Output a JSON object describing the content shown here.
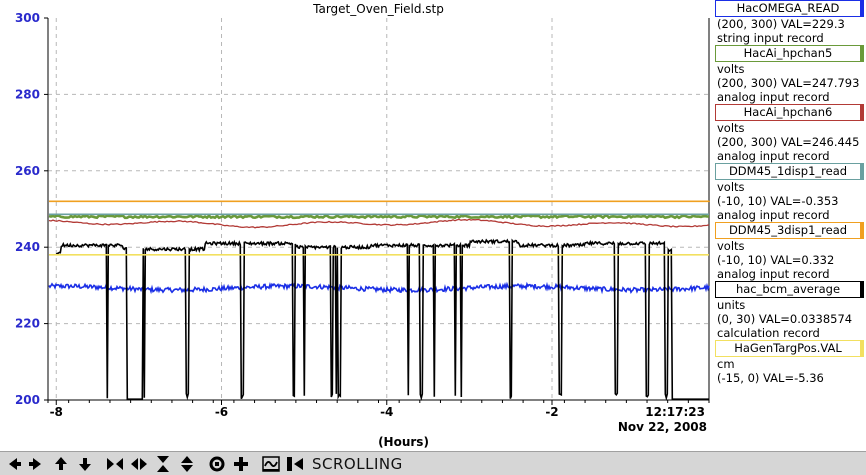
{
  "chart_data": {
    "type": "line",
    "title": "Target_Oven_Field.stp",
    "xlabel": "(Hours)",
    "ylabel": "",
    "xlim": [
      -8.1,
      -0.1
    ],
    "ylim": [
      200,
      300
    ],
    "xticks": [
      -8,
      -6,
      -4,
      -2
    ],
    "yticks": [
      200,
      220,
      240,
      260,
      280,
      300
    ],
    "grid": true,
    "time_label": "12:17:23",
    "date_label": "Nov 22, 2008",
    "series": [
      {
        "name": "HacOMEGA_READ",
        "color": "#1a2ee6",
        "level": 229.3,
        "kind": "noisy"
      },
      {
        "name": "HacAi_hpchan5",
        "color": "#6a9a3a",
        "level": 248.0,
        "kind": "band"
      },
      {
        "name": "HacAi_hpchan6",
        "color": "#b23a36",
        "level": 246.2,
        "kind": "wave"
      },
      {
        "name": "DDM45_1disp1_read",
        "color": "#6aa0a0",
        "level": 248.6,
        "kind": "flat"
      },
      {
        "name": "DDM45_3disp1_read",
        "color": "#f0a020",
        "level": 252.0,
        "kind": "flat"
      },
      {
        "name": "hac_bcm_average",
        "color": "#000000",
        "kind": "trips"
      },
      {
        "name": "HaGenTargPos.VAL",
        "color": "#f2e060",
        "level": 238.0,
        "kind": "flat"
      }
    ],
    "trips_upper_segments": [
      [
        -8.0,
        -7.95,
        238.5
      ],
      [
        -7.95,
        -7.2,
        240.5
      ],
      [
        -7.2,
        -6.2,
        239.5
      ],
      [
        -6.2,
        -5.1,
        241.0
      ],
      [
        -5.1,
        -4.2,
        240.0
      ],
      [
        -4.2,
        -3.0,
        240.5
      ],
      [
        -3.0,
        -2.4,
        241.5
      ],
      [
        -2.4,
        -1.6,
        240.5
      ],
      [
        -1.6,
        -0.6,
        241.0
      ],
      [
        -0.6,
        -0.55,
        239.0
      ]
    ],
    "trips_low_gaps": [
      [
        -7.15,
        -6.95
      ],
      [
        -0.55,
        -0.12
      ]
    ]
  },
  "legend": [
    {
      "name": "HacOMEGA_READ",
      "color": "#1a2ee6",
      "unit": "",
      "range_line": "(200, 300) VAL=229.3",
      "record": "string input record"
    },
    {
      "name": "HacAi_hpchan5",
      "color": "#6a9a3a",
      "unit": "volts",
      "range_line": "(200, 300) VAL=247.793",
      "record": "analog input record"
    },
    {
      "name": "HacAi_hpchan6",
      "color": "#b23a36",
      "unit": "volts",
      "range_line": "(200, 300) VAL=246.445",
      "record": "analog input record"
    },
    {
      "name": "DDM45_1disp1_read",
      "color": "#6aa0a0",
      "unit": "volts",
      "range_line": "(-10, 10) VAL=-0.353",
      "record": "analog input record"
    },
    {
      "name": "DDM45_3disp1_read",
      "color": "#f0a020",
      "unit": "volts",
      "range_line": "(-10, 10) VAL=0.332",
      "record": "analog input record"
    },
    {
      "name": "hac_bcm_average",
      "color": "#000000",
      "unit": "units",
      "range_line": "(0, 30) VAL=0.0338574",
      "record": "calculation record"
    },
    {
      "name": "HaGenTargPos.VAL",
      "color": "#f2e060",
      "unit": "cm",
      "range_line": "(-15, 0) VAL=-5.36",
      "record": ""
    }
  ],
  "toolbar": {
    "buttons": [
      {
        "name": "pan-left-icon"
      },
      {
        "name": "pan-right-icon"
      },
      {
        "name": "pan-up-icon"
      },
      {
        "name": "pan-down-icon"
      },
      {
        "name": "zoom-in-x-icon"
      },
      {
        "name": "zoom-out-x-icon"
      },
      {
        "name": "zoom-in-y-icon"
      },
      {
        "name": "zoom-out-y-icon"
      },
      {
        "name": "reset-icon"
      },
      {
        "name": "add-icon"
      },
      {
        "name": "auto-scale-icon"
      },
      {
        "name": "scroll-mode-icon"
      }
    ],
    "mode_label": "SCROLLING"
  }
}
